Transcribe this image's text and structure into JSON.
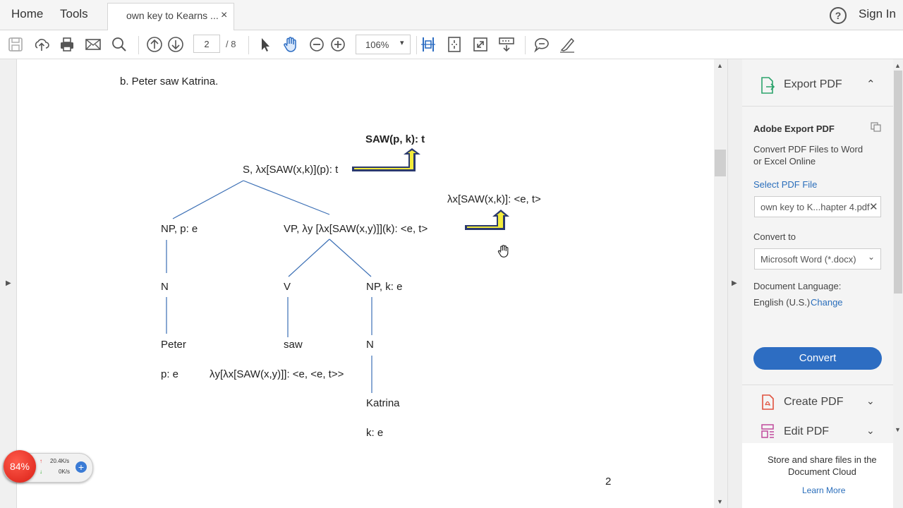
{
  "menu": {
    "home": "Home",
    "tools": "Tools",
    "sign_in": "Sign In",
    "help": "?"
  },
  "tab": {
    "label": "own key to Kearns ...",
    "close": "×"
  },
  "toolbar": {
    "page_current": "2",
    "page_total": "/ 8",
    "zoom": "106%",
    "zoom_caret": "▾"
  },
  "toolbar_icons": [
    "save-icon",
    "upload-icon",
    "print-icon",
    "email-icon",
    "search-icon",
    "page-up-icon",
    "page-down-icon",
    "select-arrow-icon",
    "hand-icon",
    "zoom-out-icon",
    "zoom-in-icon",
    "fit-width-icon",
    "fit-page-icon",
    "fullscreen-icon",
    "read-mode-icon",
    "comment-icon",
    "highlight-icon"
  ],
  "document": {
    "heading": "b. Peter saw Katrina.",
    "top_result": "SAW(p, k): t",
    "s_node": "S, λx[SAW(x,k)](p): t",
    "lambda_mid": "λx[SAW(x,k)]: <e, t>",
    "np_left": "NP, p: e",
    "vp_node": "VP, λy [λx[SAW(x,y)]](k): <e, t>",
    "n_left": "N",
    "v_node": "V",
    "np_right": "NP, k: e",
    "peter": "Peter",
    "saw": "saw",
    "n_right": "N",
    "p_e": "p: e",
    "saw_type": "λy[λx[SAW(x,y)]]: <e, <e, t>>",
    "katrina": "Katrina",
    "k_e": "k: e",
    "page_number": "2"
  },
  "arrow_color": "#2b3a6e",
  "arrow_fill": "#f3ec3c",
  "panel": {
    "export_title": "Export PDF",
    "adobe_export": "Adobe Export PDF",
    "desc1": "Convert PDF Files to Word",
    "desc2": "or Excel Online",
    "select_file": "Select PDF File",
    "file_name": "own key to K...hapter 4.pdf",
    "convert_to": "Convert to",
    "format": "Microsoft Word (*.docx)",
    "doc_lang": "Document Language:",
    "lang_value": "English (U.S.)",
    "change": "Change",
    "convert_btn": "Convert",
    "create_pdf": "Create PDF",
    "edit_pdf": "Edit PDF",
    "cloud1": "Store and share files in the",
    "cloud2": "Document Cloud",
    "learn_more": "Learn More"
  },
  "speed": {
    "percent": "84%",
    "up": "20.4K/s",
    "down": "0K/s"
  }
}
